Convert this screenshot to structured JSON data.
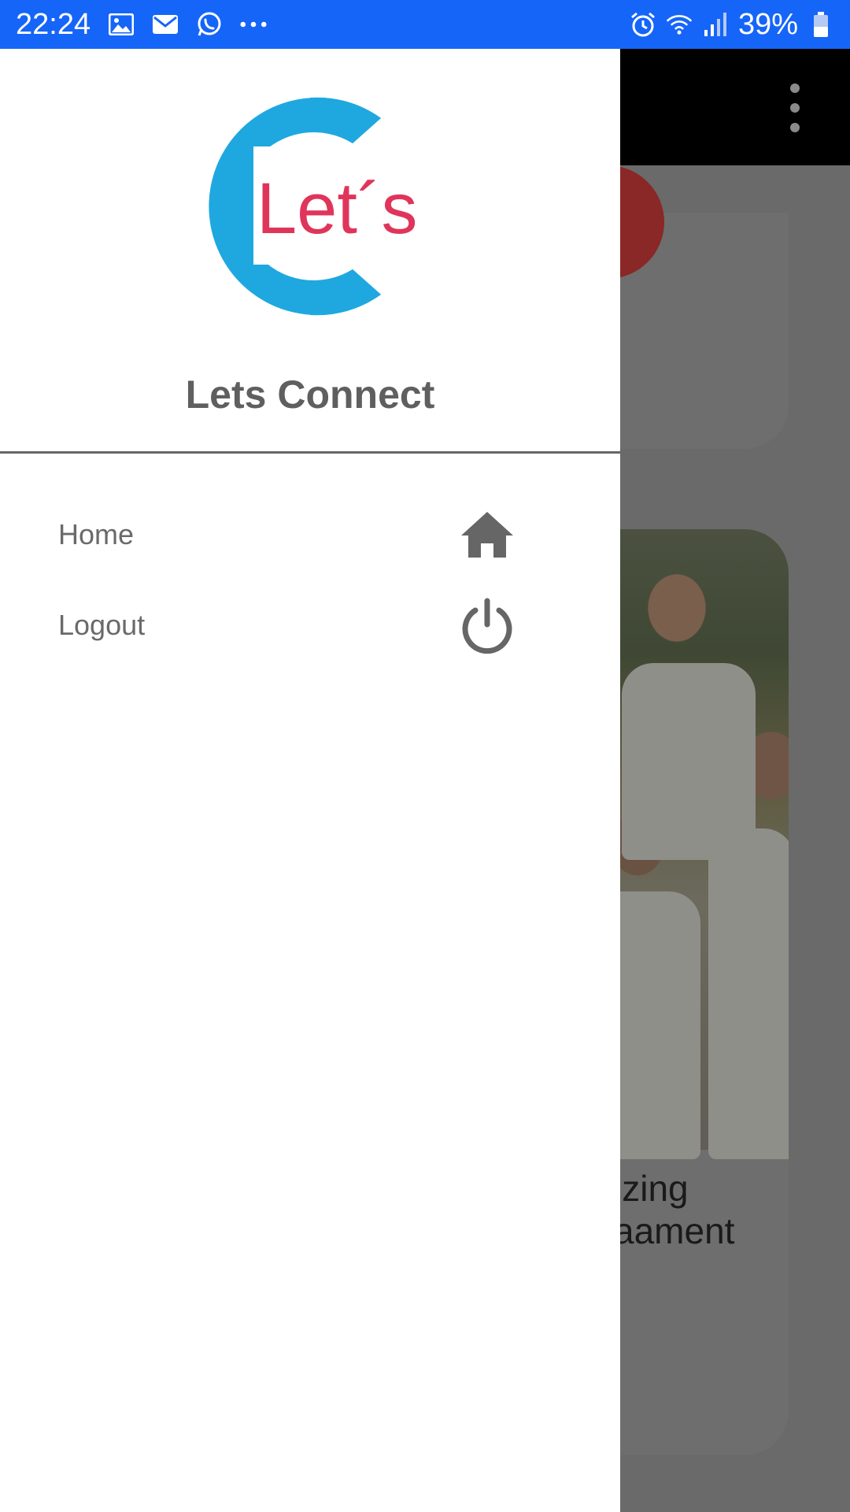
{
  "status_bar": {
    "time": "22:24",
    "battery": "39%",
    "left_icons": [
      "image-icon",
      "email-icon",
      "whatsapp-icon",
      "more-notifications-icon"
    ],
    "right_icons": [
      "alarm-icon",
      "wifi-icon",
      "signal-icon",
      "battery-icon"
    ],
    "color": "#1565f8"
  },
  "drawer": {
    "app_name": "Lets Connect",
    "logo": {
      "text": "Let´s",
      "circle_color": "#1fa8df",
      "text_color": "#e0355b"
    },
    "menu": [
      {
        "label": "Home",
        "icon": "home-icon"
      },
      {
        "label": "Logout",
        "icon": "power-icon"
      }
    ]
  },
  "background": {
    "card_caption": "izing\naament"
  }
}
